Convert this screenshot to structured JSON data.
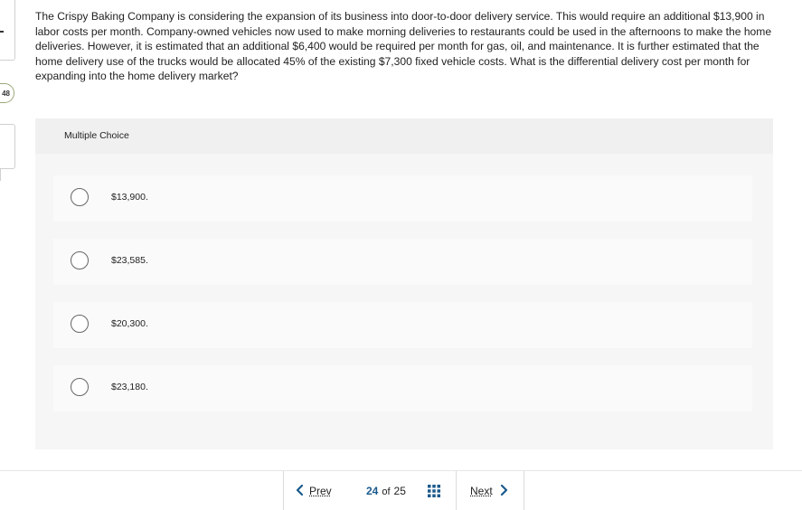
{
  "left_rail": {
    "badge": "48"
  },
  "question": {
    "text": "The Crispy Baking Company is considering the expansion of its business into door-to-door delivery service. This would require an additional $13,900 in labor costs per month. Company-owned vehicles now used to make morning deliveries to restaurants could be used in the afternoons to make the home deliveries. However, it is estimated that an additional $6,400 would be required per month for gas, oil, and maintenance. It is further estimated that the home delivery use of the trucks would be allocated 45% of the existing $7,300 fixed vehicle costs. What is the differential delivery cost per month for expanding into the home delivery market?"
  },
  "multiple_choice": {
    "title": "Multiple Choice",
    "options": [
      {
        "label": "$13,900.",
        "selected": false
      },
      {
        "label": "$23,585.",
        "selected": false
      },
      {
        "label": "$20,300.",
        "selected": false
      },
      {
        "label": "$23,180.",
        "selected": false
      }
    ]
  },
  "navigation": {
    "prev_label": "Prev",
    "current_page": "24",
    "of_label": "of",
    "total_pages": "25",
    "next_label": "Next",
    "grid_icon": "grid-icon",
    "accent_color": "#1b5a8c"
  }
}
